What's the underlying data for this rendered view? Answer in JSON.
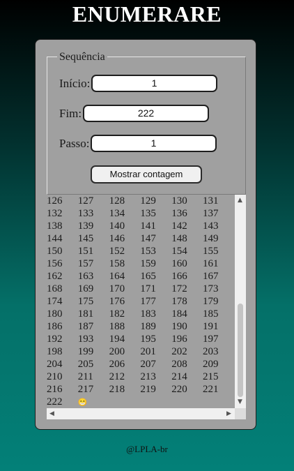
{
  "page": {
    "title": "ENUMERARE",
    "footer": "@LPLA-br"
  },
  "form": {
    "legend": "Sequência",
    "start_label": "Início:",
    "start_value": "1",
    "end_label": "Fim:",
    "end_value": "222",
    "step_label": "Passo:",
    "step_value": "1",
    "button_label": "Mostrar contagem"
  },
  "output": {
    "rows": [
      [
        "126",
        "127",
        "128",
        "129",
        "130",
        "131"
      ],
      [
        "132",
        "133",
        "134",
        "135",
        "136",
        "137"
      ],
      [
        "138",
        "139",
        "140",
        "141",
        "142",
        "143"
      ],
      [
        "144",
        "145",
        "146",
        "147",
        "148",
        "149"
      ],
      [
        "150",
        "151",
        "152",
        "153",
        "154",
        "155"
      ],
      [
        "156",
        "157",
        "158",
        "159",
        "160",
        "161"
      ],
      [
        "162",
        "163",
        "164",
        "165",
        "166",
        "167"
      ],
      [
        "168",
        "169",
        "170",
        "171",
        "172",
        "173"
      ],
      [
        "174",
        "175",
        "176",
        "177",
        "178",
        "179"
      ],
      [
        "180",
        "181",
        "182",
        "183",
        "184",
        "185"
      ],
      [
        "186",
        "187",
        "188",
        "189",
        "190",
        "191"
      ],
      [
        "192",
        "193",
        "194",
        "195",
        "196",
        "197"
      ],
      [
        "198",
        "199",
        "200",
        "201",
        "202",
        "203"
      ],
      [
        "204",
        "205",
        "206",
        "207",
        "208",
        "209"
      ],
      [
        "210",
        "211",
        "212",
        "213",
        "214",
        "215"
      ],
      [
        "216",
        "217",
        "218",
        "219",
        "220",
        "221"
      ],
      [
        "222",
        "😁"
      ]
    ]
  },
  "icons": {
    "scroll_up": "▲",
    "scroll_down": "▼",
    "scroll_left": "◀",
    "scroll_right": "▶"
  }
}
